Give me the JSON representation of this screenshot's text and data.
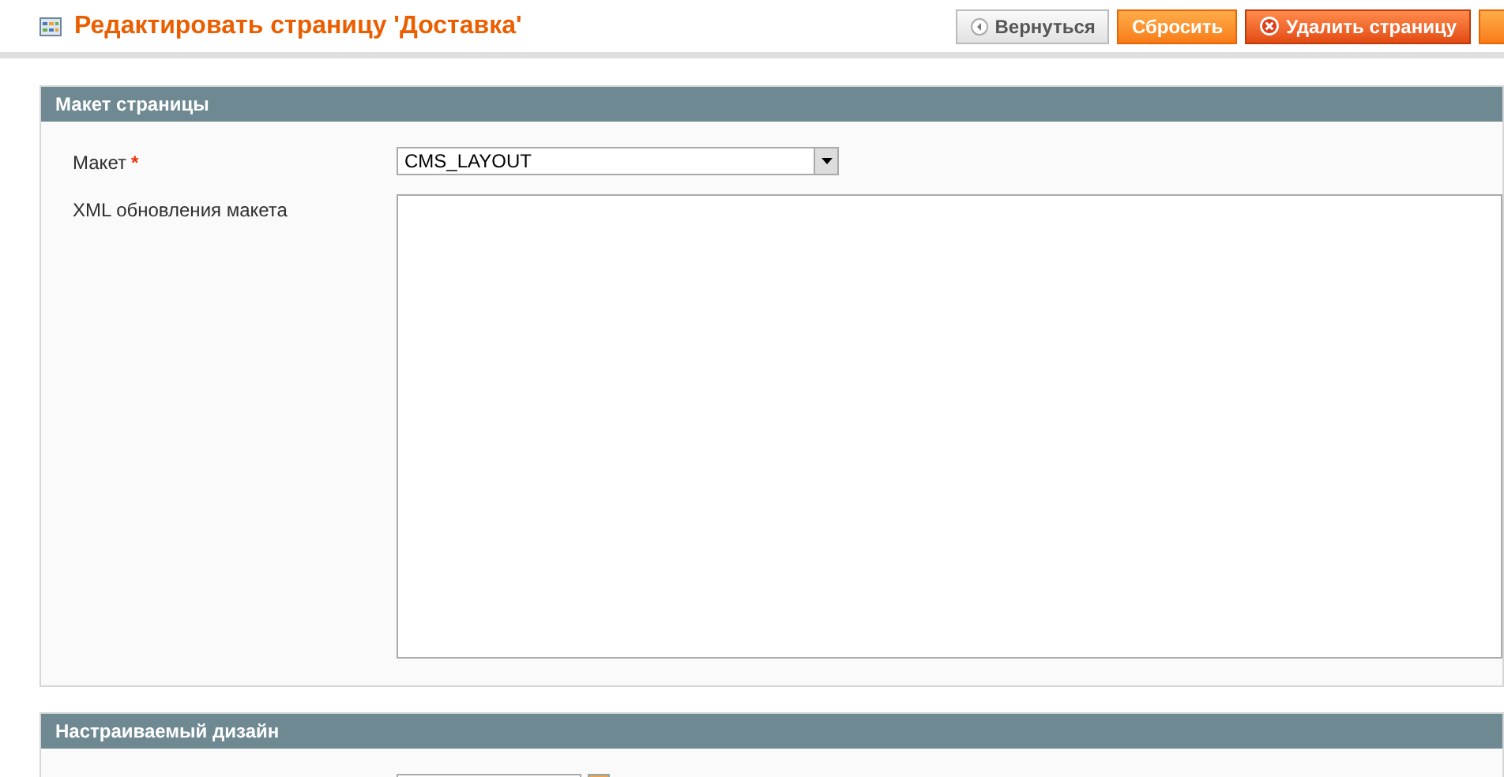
{
  "header": {
    "title": "Редактировать страницу 'Доставка'",
    "buttons": [
      {
        "label": "Вернуться",
        "kind": "back"
      },
      {
        "label": "Сбросить",
        "kind": "reset"
      },
      {
        "label": "Удалить страницу",
        "kind": "delete"
      }
    ]
  },
  "sections": [
    {
      "title": "Макет страницы",
      "fields": [
        {
          "label": "Макет",
          "required_mark": "*",
          "kind": "select",
          "value": "CMS_LAYOUT"
        },
        {
          "label": "XML обновления макета",
          "kind": "textarea"
        }
      ]
    },
    {
      "title": "Настраиваемый дизайн",
      "fields": [
        {
          "kind": "date"
        }
      ]
    }
  ]
}
